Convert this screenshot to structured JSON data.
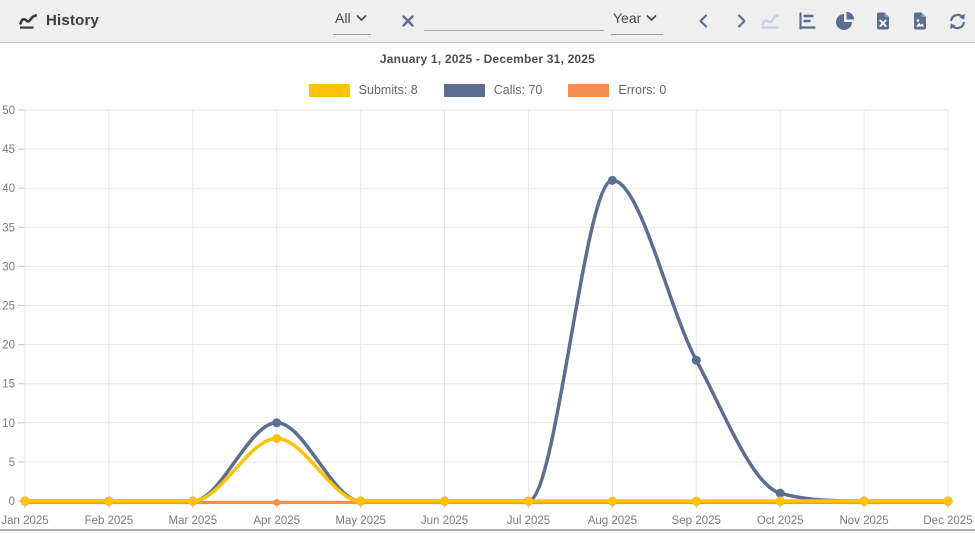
{
  "toolbar": {
    "title": "History",
    "filter_value": "All",
    "range_value": "Year",
    "search": {
      "value": "",
      "placeholder": ""
    },
    "icons": {
      "header": "history-chart-icon",
      "clear": "clear-x-icon",
      "prev": "chevron-left-icon",
      "next": "chevron-right-icon",
      "line_view": "line-chart-icon",
      "bar_view": "bar-chart-icon",
      "pie_view": "pie-chart-icon",
      "export_excel": "excel-file-icon",
      "export_image": "image-file-icon",
      "refresh": "refresh-icon"
    }
  },
  "chart_data": {
    "type": "line",
    "title": "January 1, 2025 - December 31, 2025",
    "xlabel": "",
    "ylabel": "",
    "ylim": [
      0,
      50
    ],
    "ytick_step": 5,
    "grid": true,
    "legend_position": "top",
    "categories": [
      "Jan 2025",
      "Feb 2025",
      "Mar 2025",
      "Apr 2025",
      "May 2025",
      "Jun 2025",
      "Jul 2025",
      "Aug 2025",
      "Sep 2025",
      "Oct 2025",
      "Nov 2025",
      "Dec 2025"
    ],
    "series": [
      {
        "name": "Submits",
        "legend": "Submits: 8",
        "color": "#fdc30b",
        "values": [
          0,
          0,
          0,
          8,
          0,
          0,
          0,
          0,
          0,
          0,
          0,
          0
        ]
      },
      {
        "name": "Calls",
        "legend": "Calls: 70",
        "color": "#5b6e8f",
        "values": [
          0,
          0,
          0,
          10,
          0,
          0,
          0,
          41,
          18,
          1,
          0,
          0
        ]
      },
      {
        "name": "Errors",
        "legend": "Errors: 0",
        "color": "#f2914e",
        "values": [
          0,
          0,
          0,
          0,
          0,
          0,
          0,
          0,
          0,
          0,
          0,
          0
        ]
      }
    ]
  }
}
